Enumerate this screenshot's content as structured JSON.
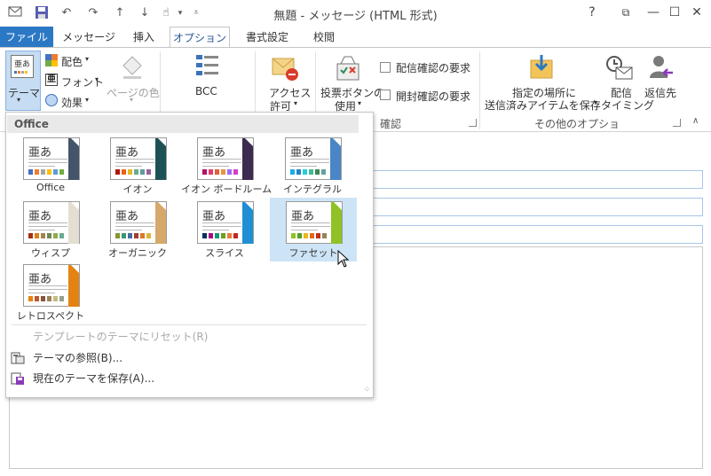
{
  "window": {
    "title": "無題 - メッセージ (HTML 形式)",
    "help": "?",
    "restore": "⧉",
    "minimize": "—",
    "maximize": "☐",
    "close": "✕"
  },
  "qat": {
    "mail_icon": "mail-icon",
    "save_icon": "save-icon",
    "undo_icon": "undo-icon",
    "redo_icon": "redo-icon",
    "up_icon": "arrow-up-icon",
    "down_icon": "arrow-down-icon",
    "touch_icon": "touch-mode-icon",
    "customize": "customize-qat-icon"
  },
  "tabs": [
    {
      "label": "ファイル"
    },
    {
      "label": "メッセージ"
    },
    {
      "label": "挿入"
    },
    {
      "label": "オプション"
    },
    {
      "label": "書式設定"
    },
    {
      "label": "校閲"
    }
  ],
  "ribbon": {
    "theme_label": "テーマ",
    "colors_label": "配色",
    "fonts_label": "フォント",
    "effects_label": "効果",
    "page_color_label": "ページの色",
    "bcc_label": "BCC",
    "access_label_1": "アクセス",
    "access_label_2": "許可",
    "voting_label_1": "投票ボタンの",
    "voting_label_2": "使用",
    "delivery_receipt": "配信確認の要求",
    "read_receipt": "開封確認の要求",
    "confirm_group": "確認",
    "save_sent_1": "指定の場所に",
    "save_sent_2": "送信済みアイテムを保存",
    "delay_1": "配信",
    "delay_2": "タイミング",
    "reply_to": "返信先",
    "more_options_group": "その他のオプション"
  },
  "dropdown": {
    "header": "Office",
    "themes": [
      {
        "name": "Office",
        "accent": "#44546a",
        "swatches": [
          "#4472c4",
          "#ed7d31",
          "#a5a5a5",
          "#ffc000",
          "#5b9bd5",
          "#70ad47"
        ]
      },
      {
        "name": "イオン",
        "accent": "#1e5155",
        "swatches": [
          "#b01513",
          "#ea6312",
          "#e6b729",
          "#6aac90",
          "#5f9c9d",
          "#9e5e9b"
        ]
      },
      {
        "name": "イオン ボードルーム",
        "accent": "#3c2a4f",
        "swatches": [
          "#b31166",
          "#e33d6f",
          "#e45f3c",
          "#e9943a",
          "#9b6bf2",
          "#d53dd0"
        ]
      },
      {
        "name": "インテグラル",
        "accent": "#4a86c5",
        "swatches": [
          "#1cade4",
          "#2683c6",
          "#27ced7",
          "#42ba97",
          "#3e8853",
          "#62a39f"
        ]
      },
      {
        "name": "ウィスプ",
        "accent": "#e3ded1",
        "swatches": [
          "#a53010",
          "#de7e18",
          "#9f8351",
          "#728653",
          "#92aa4c",
          "#6aac91"
        ]
      },
      {
        "name": "オーガニック",
        "accent": "#d6a86a",
        "swatches": [
          "#83992a",
          "#3c9770",
          "#44709d",
          "#a23c33",
          "#d97828",
          "#deb340"
        ]
      },
      {
        "name": "スライス",
        "accent": "#1f8fd5",
        "swatches": [
          "#052f61",
          "#a50e82",
          "#14967c",
          "#6a9e1f",
          "#e87d37",
          "#c62324"
        ]
      },
      {
        "name": "ファセット",
        "accent": "#90c226",
        "swatches": [
          "#90c226",
          "#54a021",
          "#e6b91e",
          "#e76618",
          "#c42f1a",
          "#918655"
        ]
      },
      {
        "name": "レトロスペクト",
        "accent": "#e48312",
        "swatches": [
          "#e48312",
          "#bd582c",
          "#865640",
          "#9b8357",
          "#c2bc80",
          "#94a088"
        ]
      }
    ],
    "reset_theme": "テンプレートのテーマにリセット(R)",
    "browse_themes": "テーマの参照(B)...",
    "save_theme": "現在のテーマを保存(A)..."
  }
}
